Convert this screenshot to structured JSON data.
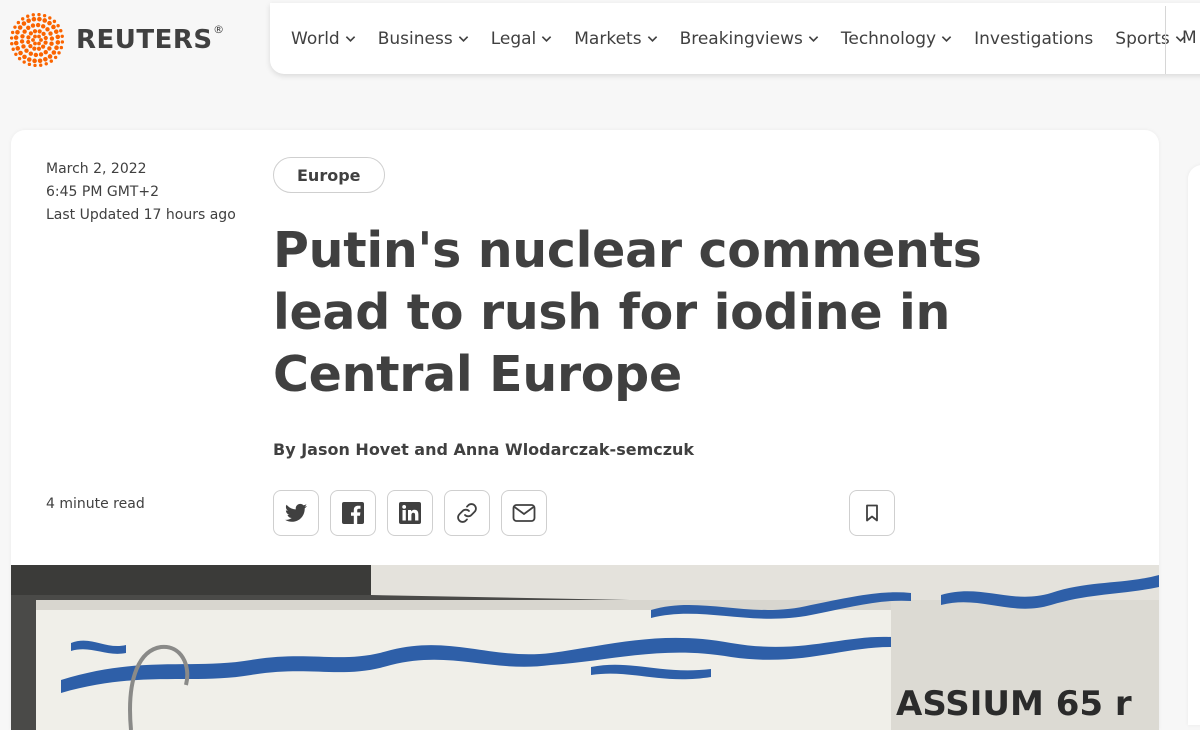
{
  "brand": {
    "name": "REUTERS",
    "reg": "®",
    "accent": "#fa6400"
  },
  "nav": {
    "items": [
      "World",
      "Business",
      "Legal",
      "Markets",
      "Breakingviews",
      "Technology",
      "Investigations",
      "Sports"
    ],
    "has_dropdown": [
      true,
      true,
      true,
      true,
      true,
      true,
      false,
      true
    ],
    "more_partial": "M"
  },
  "article": {
    "date": "March 2, 2022",
    "time": "6:45 PM GMT+2",
    "updated": "Last Updated 17 hours ago",
    "section": "Europe",
    "headline": "Putin's nuclear comments lead to rush for iodine in Central Europe",
    "byline": "By Jason Hovet and Anna Wlodarczak-semczuk",
    "read_time": "4 minute read"
  },
  "share": {
    "icons": [
      "twitter-icon",
      "facebook-icon",
      "linkedin-icon",
      "link-icon",
      "email-icon"
    ]
  },
  "photo": {
    "visible_text": "ASSIUM 65 r"
  }
}
